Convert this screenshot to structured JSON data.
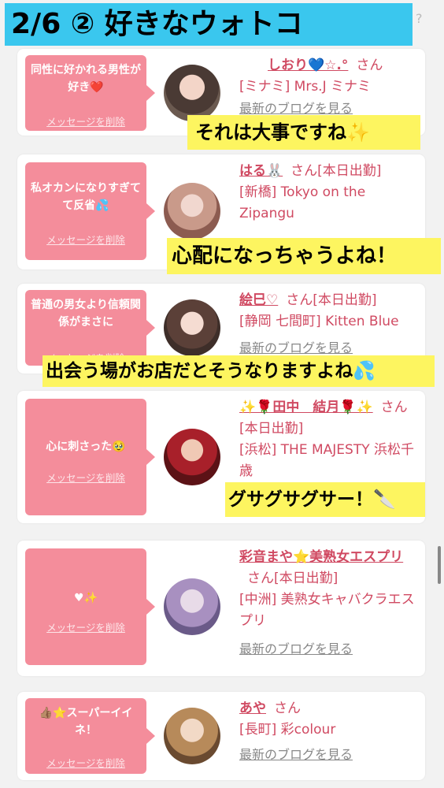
{
  "header": {
    "title": "2/6 ② 好きなウォトコ",
    "corner_mark": "?"
  },
  "cards": [
    {
      "message": "同性に好かれる男性が好き❤️",
      "delete_label": "メッセージを削除",
      "name": "しおり💙☆.°",
      "san": "さん",
      "shop": "[ミナミ] Mrs.J ミナミ",
      "blog": "最新のブログを見る"
    },
    {
      "message": "私オカンになりすぎてて反省💦",
      "delete_label": "メッセージを削除",
      "name": "はる🐰",
      "san": "さん[本日出勤]",
      "shop": "[新橋] Tokyo on the Zipangu",
      "blog": ""
    },
    {
      "message": "普通の男女より信頼関係がまさに",
      "delete_label": "メッセージを削除",
      "name": "絵巳♡",
      "san": "さん[本日出勤]",
      "shop": "[静岡 七間町] Kitten Blue",
      "blog": "最新のブログを見る"
    },
    {
      "message": "心に刺さった🥹",
      "delete_label": "メッセージを削除",
      "name": "✨🌹田中　結月🌹✨",
      "san": "さん[本日出勤]",
      "shop": "[浜松] THE MAJESTY 浜松千歳",
      "blog": ""
    },
    {
      "message": "♥✨",
      "delete_label": "メッセージを削除",
      "name": "彩音まや⭐美熟女エスプリ",
      "san": "さん[本日出勤]",
      "shop": "[中洲] 美熟女キャバクラエスプリ",
      "blog": "最新のブログを見る"
    },
    {
      "message": "👍🏽⭐スーパーイイネ！",
      "delete_label": "メッセージを削除",
      "name": "あや",
      "san": "さん",
      "shop": "[長町] 彩colour",
      "blog": "最新のブログを見る"
    }
  ],
  "overlays": [
    "それは大事ですね✨",
    "心配になっちゃうよね！",
    "出会う場がお店だとそうなりますよね💦",
    "グサグサグサー！🔪"
  ]
}
